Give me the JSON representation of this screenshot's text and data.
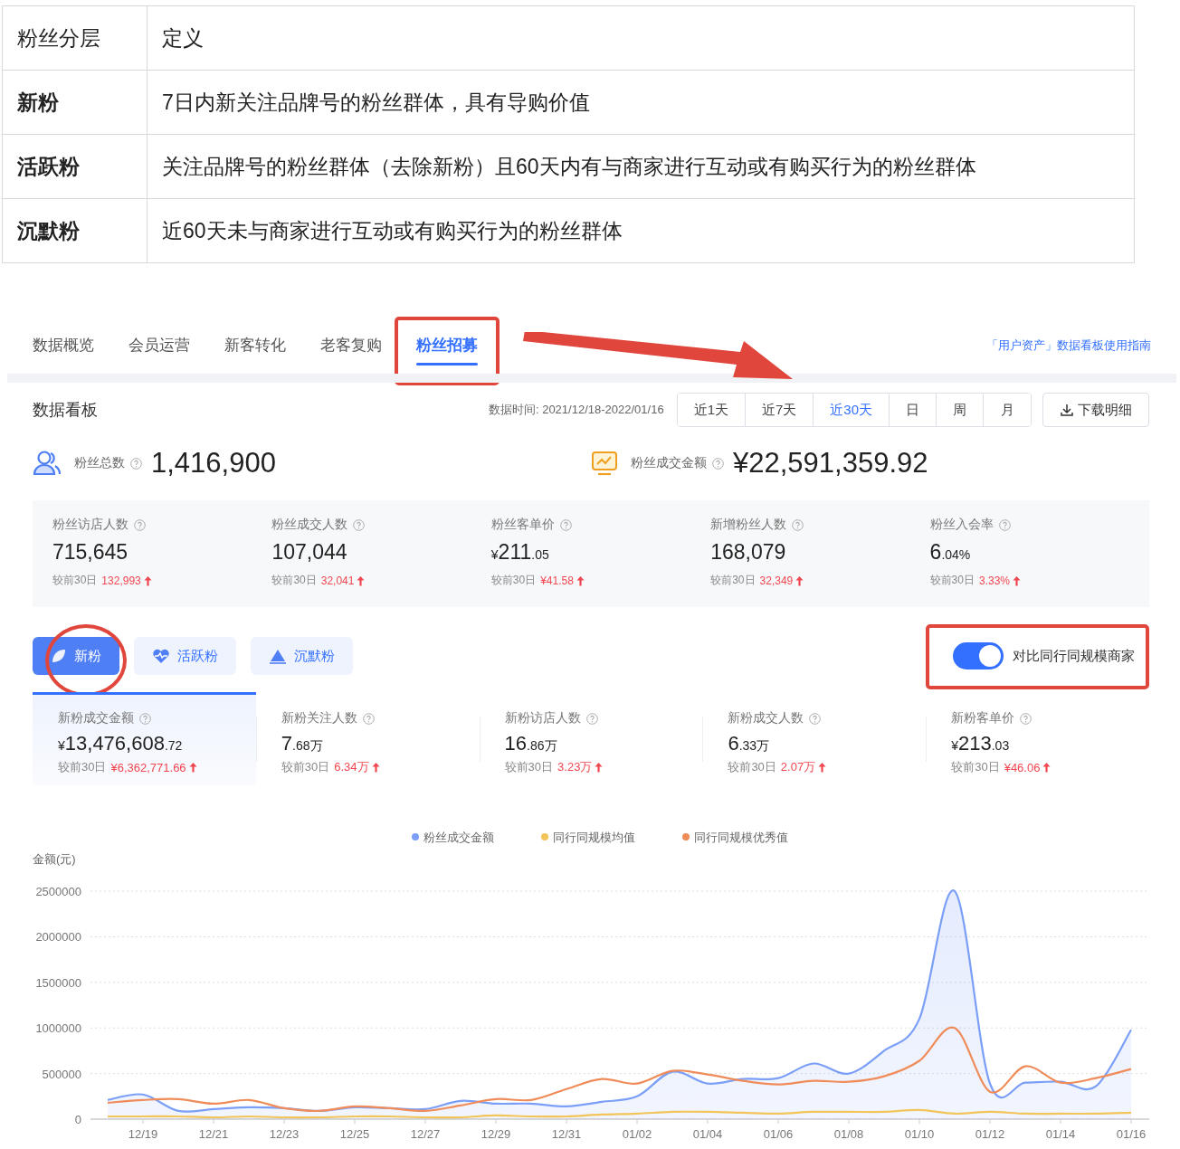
{
  "definition_table": {
    "columns": [
      "粉丝分层",
      "定义"
    ],
    "rows": [
      {
        "tier": "新粉",
        "definition": "7日内新关注品牌号的粉丝群体，具有导购价值"
      },
      {
        "tier": "活跃粉",
        "definition": "关注品牌号的粉丝群体（去除新粉）且60天内有与商家进行互动或有购买行为的粉丝群体"
      },
      {
        "tier": "沉默粉",
        "definition": "近60天未与商家进行互动或有购买行为的粉丝群体"
      }
    ]
  },
  "tabs": [
    {
      "label": "数据概览",
      "selected": false,
      "annotated": false
    },
    {
      "label": "会员运营",
      "selected": false,
      "annotated": false
    },
    {
      "label": "新客转化",
      "selected": false,
      "annotated": false
    },
    {
      "label": "老客复购",
      "selected": false,
      "annotated": false
    },
    {
      "label": "粉丝招募",
      "selected": true,
      "annotated": true
    }
  ],
  "guide_link": "「用户资产」数据看板使用指南",
  "board": {
    "title": "数据看板",
    "date_label": "数据时间:",
    "date_range": "2021/12/18-2022/01/16",
    "periods": [
      {
        "label": "近1天",
        "selected": false
      },
      {
        "label": "近7天",
        "selected": false
      },
      {
        "label": "近30天",
        "selected": true
      },
      {
        "label": "日",
        "selected": false
      },
      {
        "label": "周",
        "selected": false
      },
      {
        "label": "月",
        "selected": false
      }
    ],
    "download": "下载明细"
  },
  "summary": [
    {
      "kind": "users",
      "label": "粉丝总数",
      "value": "1,416,900"
    },
    {
      "kind": "sales",
      "label": "粉丝成交金额",
      "value": "¥22,591,359.92"
    }
  ],
  "metrics": [
    {
      "label": "粉丝访店人数",
      "value": "715,645",
      "compare_label": "较前30日",
      "change": "132,993"
    },
    {
      "label": "粉丝成交人数",
      "value": "107,044",
      "compare_label": "较前30日",
      "change": "32,041"
    },
    {
      "label": "粉丝客单价",
      "value": "¥211.05",
      "compare_label": "较前30日",
      "change": "¥41.58"
    },
    {
      "label": "新增粉丝人数",
      "value": "168,079",
      "compare_label": "较前30日",
      "change": "32,349"
    },
    {
      "label": "粉丝入会率",
      "value": "6.04%",
      "compare_label": "较前30日",
      "change": "3.33%"
    }
  ],
  "segments": [
    {
      "kind": "leaf",
      "label": "新粉",
      "selected": true,
      "annotated": true
    },
    {
      "kind": "heart",
      "label": "活跃粉",
      "selected": false,
      "annotated": false
    },
    {
      "kind": "mountain",
      "label": "沉默粉",
      "selected": false,
      "annotated": false
    }
  ],
  "compare_toggle": {
    "label": "对比同行同规模商家",
    "on": true,
    "annotated": true
  },
  "fan_metrics": [
    {
      "label": "新粉成交金额",
      "value": "¥13,476,608.72",
      "compare_label": "较前30日",
      "change": "¥6,362,771.66",
      "selected": true
    },
    {
      "label": "新粉关注人数",
      "value": "7.68万",
      "compare_label": "较前30日",
      "change": "6.34万",
      "selected": false
    },
    {
      "label": "新粉访店人数",
      "value": "16.86万",
      "compare_label": "较前30日",
      "change": "3.23万",
      "selected": false
    },
    {
      "label": "新粉成交人数",
      "value": "6.33万",
      "compare_label": "较前30日",
      "change": "2.07万",
      "selected": false
    },
    {
      "label": "新粉客单价",
      "value": "¥213.03",
      "compare_label": "较前30日",
      "change": "¥46.06",
      "selected": false
    }
  ],
  "chart_data": {
    "type": "line",
    "ylabel": "金额(元)",
    "grid": true,
    "legend": "top",
    "categories": [
      null,
      "12/19",
      null,
      "12/21",
      null,
      "12/23",
      null,
      "12/25",
      null,
      "12/27",
      null,
      "12/29",
      null,
      "12/31",
      null,
      "01/02",
      null,
      "01/04",
      null,
      "01/06",
      null,
      "01/08",
      null,
      "01/10",
      null,
      "01/12",
      null,
      "01/14",
      null,
      "01/16"
    ],
    "ylim": [
      0,
      2500000
    ],
    "yticks": [
      0,
      500000,
      1000000,
      1500000,
      2000000,
      2500000
    ],
    "series": [
      {
        "name": "粉丝成交金额",
        "type": "area",
        "color": "#7b9ef7",
        "values": [
          210000,
          270000,
          90000,
          110000,
          130000,
          120000,
          90000,
          130000,
          120000,
          110000,
          200000,
          170000,
          170000,
          140000,
          190000,
          250000,
          520000,
          390000,
          440000,
          450000,
          610000,
          500000,
          750000,
          1100000,
          2500000,
          390000,
          400000,
          410000,
          360000,
          980000
        ]
      },
      {
        "name": "同行同规模均值",
        "type": "line",
        "color": "#f2c45a",
        "values": [
          30000,
          30000,
          30000,
          20000,
          30000,
          20000,
          20000,
          30000,
          30000,
          20000,
          20000,
          40000,
          30000,
          30000,
          50000,
          60000,
          80000,
          80000,
          70000,
          60000,
          80000,
          80000,
          80000,
          100000,
          60000,
          80000,
          60000,
          60000,
          60000,
          70000
        ]
      },
      {
        "name": "同行同规模优秀值",
        "type": "line",
        "color": "#ef8c5a",
        "values": [
          180000,
          210000,
          220000,
          170000,
          210000,
          120000,
          90000,
          140000,
          120000,
          90000,
          150000,
          220000,
          210000,
          330000,
          440000,
          390000,
          530000,
          490000,
          420000,
          380000,
          420000,
          410000,
          470000,
          640000,
          1000000,
          300000,
          580000,
          400000,
          450000,
          550000
        ]
      }
    ]
  }
}
